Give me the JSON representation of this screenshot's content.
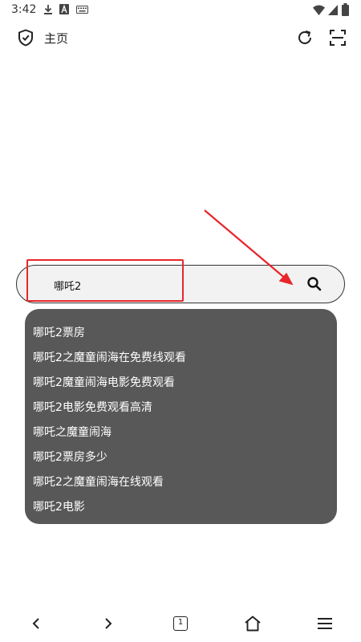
{
  "status_bar": {
    "time": "3:42",
    "icons": [
      "download-icon",
      "text-a-icon",
      "keyboard-icon",
      "wifi-icon",
      "signal-icon",
      "battery-icon"
    ]
  },
  "header": {
    "title": "主页",
    "icons": [
      "shield-check-icon",
      "refresh-icon",
      "scan-icon"
    ]
  },
  "search": {
    "value": "哪吒2",
    "button_icon": "search-icon"
  },
  "suggestions": [
    "哪吒2票房",
    "哪吒2之魔童闹海在免费线观看",
    "哪吒2魔童闹海电影免费观看",
    "哪吒2电影免费观看高清",
    "哪吒之魔童闹海",
    "哪吒2票房多少",
    "哪吒2之魔童闹海在线观看",
    "哪吒2电影"
  ],
  "bottom_nav": {
    "tab_count": "1",
    "icons": [
      "back-icon",
      "forward-icon",
      "tabs-icon",
      "home-icon",
      "menu-icon"
    ]
  },
  "colors": {
    "annotation": "#e8262b",
    "suggestion_bg": "#585858",
    "search_bg": "#f2f2f2"
  }
}
